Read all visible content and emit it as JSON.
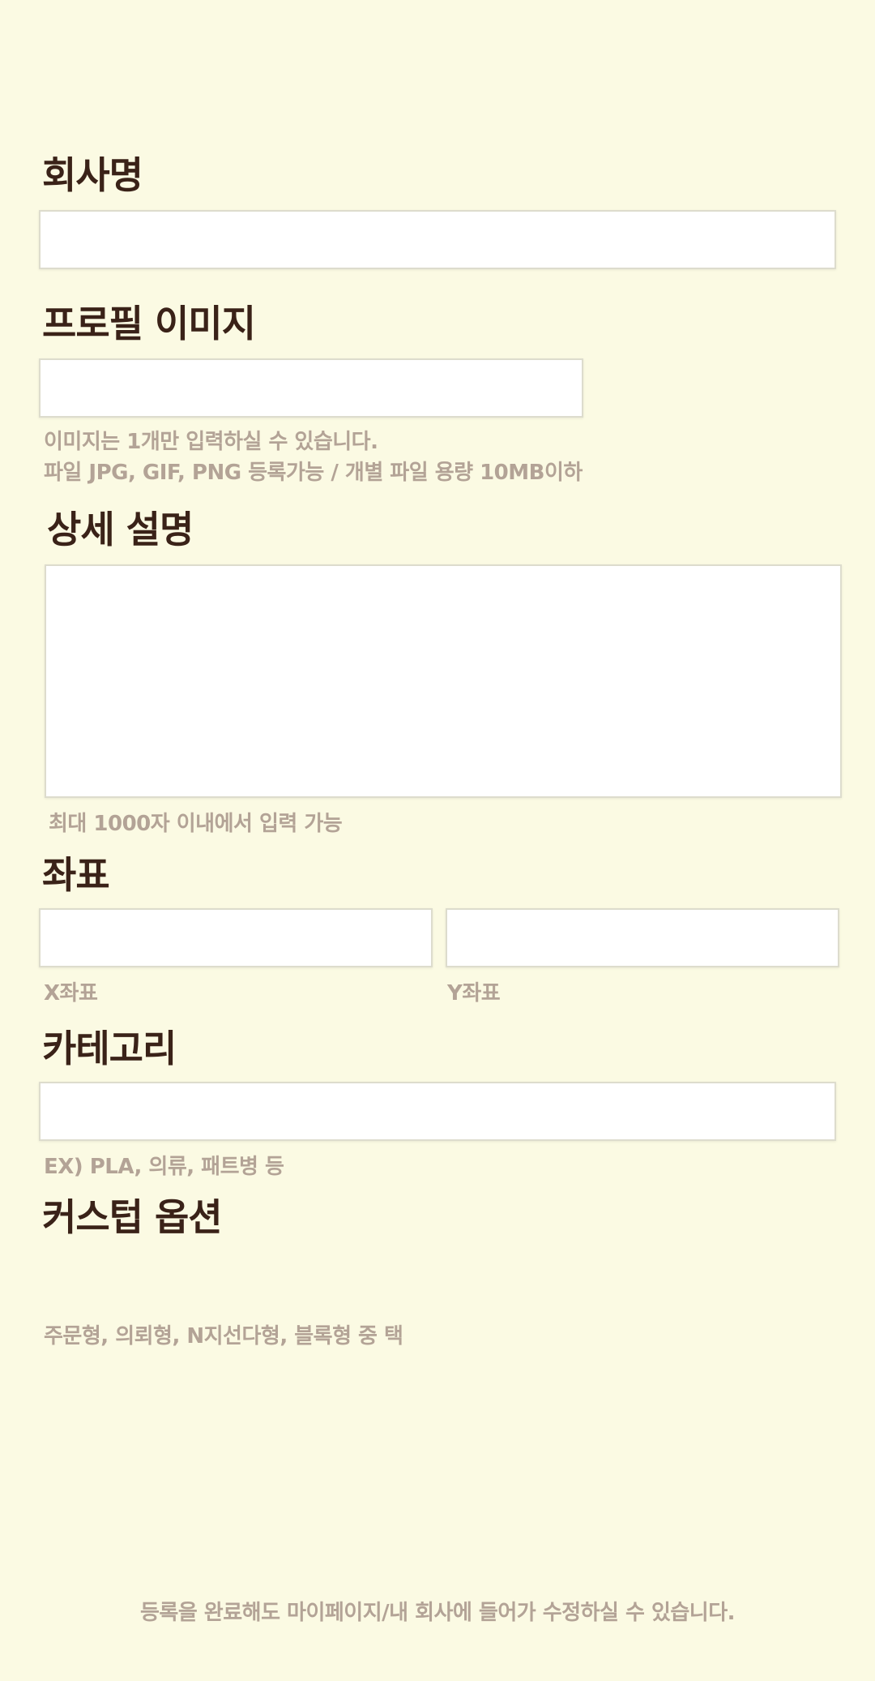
{
  "company": {
    "label": "회사명",
    "value": ""
  },
  "profile_image": {
    "label": "프로필 이미지",
    "value": "",
    "help_line1": "이미지는 1개만 입력하실 수 있습니다.",
    "help_line2": "파일 JPG, GIF, PNG 등록가능 / 개별 파일 용량 10MB이하"
  },
  "description": {
    "label": "상세 설명",
    "value": "",
    "help": "최대 1000자 이내에서 입력 가능"
  },
  "coordinates": {
    "label": "좌표",
    "x_value": "",
    "y_value": "",
    "x_help": "X좌표",
    "y_help": "Y좌표"
  },
  "category": {
    "label": "카테고리",
    "value": "",
    "help": "EX) PLA, 의류, 패트병 등"
  },
  "custom_option": {
    "label": "커스텁 옵션",
    "help": "주문형, 의뢰형, N지선다형, 블록형 중 택"
  },
  "footer": {
    "note": "등록을 완료해도 마이페이지/내 회사에 들어가 수정하실 수 있습니다."
  }
}
